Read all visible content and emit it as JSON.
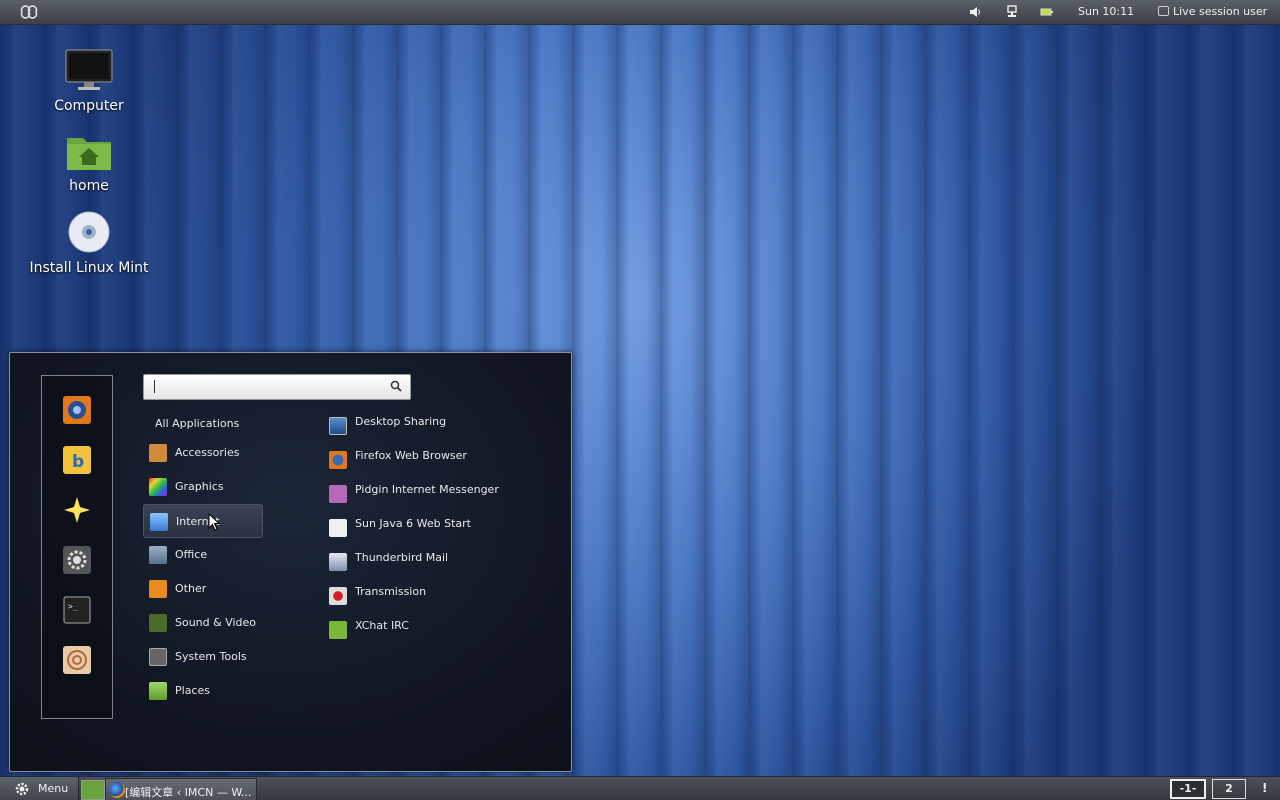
{
  "top_panel": {
    "clock": "Sun 10:11",
    "user": "Live session user"
  },
  "desktop_icons": [
    {
      "label": "Computer"
    },
    {
      "label": "home"
    },
    {
      "label": "Install Linux Mint"
    }
  ],
  "menu": {
    "search_value": "",
    "categories_header": "All Applications",
    "categories": [
      {
        "label": "Accessories",
        "icon": "accessories-icon",
        "active": false
      },
      {
        "label": "Graphics",
        "icon": "graphics-icon",
        "active": false
      },
      {
        "label": "Internet",
        "icon": "internet-icon",
        "active": true
      },
      {
        "label": "Office",
        "icon": "office-icon",
        "active": false
      },
      {
        "label": "Other",
        "icon": "other-icon",
        "active": false
      },
      {
        "label": "Sound & Video",
        "icon": "sound-video-icon",
        "active": false
      },
      {
        "label": "System Tools",
        "icon": "system-tools-icon",
        "active": false
      },
      {
        "label": "Places",
        "icon": "places-folder-icon",
        "active": false
      }
    ],
    "applications": [
      {
        "label": "Desktop Sharing",
        "icon": "desktop-sharing-icon"
      },
      {
        "label": "Firefox Web Browser",
        "icon": "firefox-icon"
      },
      {
        "label": "Pidgin Internet Messenger",
        "icon": "pidgin-icon"
      },
      {
        "label": "Sun Java 6 Web Start",
        "icon": "java-icon"
      },
      {
        "label": "Thunderbird Mail",
        "icon": "thunderbird-icon"
      },
      {
        "label": "Transmission",
        "icon": "transmission-icon"
      },
      {
        "label": "XChat IRC",
        "icon": "xchat-icon"
      }
    ],
    "favorites": [
      {
        "icon": "firefox-icon"
      },
      {
        "icon": "banshee-icon"
      },
      {
        "icon": "star-icon"
      },
      {
        "icon": "settings-icon"
      },
      {
        "icon": "terminal-icon"
      },
      {
        "icon": "nautilus-icon"
      }
    ]
  },
  "bottom_panel": {
    "menu_label": "Menu",
    "task_label": "[编辑文章 ‹ IMCN — W...",
    "workspaces": [
      "-1-",
      "2"
    ],
    "notification": "!"
  },
  "colors": {
    "accent_active_category": "#3b4352",
    "desktop_blue": "#4a78c3"
  }
}
